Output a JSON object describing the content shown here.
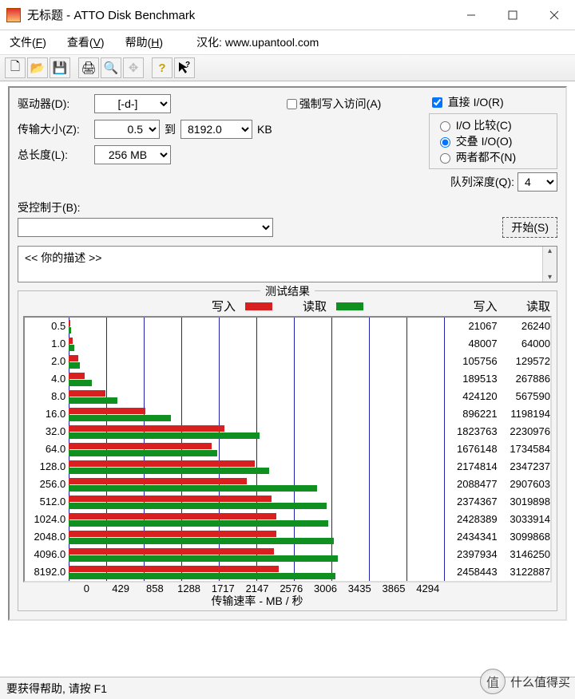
{
  "window": {
    "title": "无标题 - ATTO Disk Benchmark"
  },
  "menu": {
    "file": "文件(F)",
    "view": "查看(V)",
    "help": "帮助(H)",
    "hanhua_label": "汉化:",
    "hanhua_url": "www.upantool.com"
  },
  "options": {
    "drive_label": "驱动器(D):",
    "drive_value": "[-d-]",
    "transfer_label": "传输大小(Z):",
    "size_from": "0.5",
    "to_label": "到",
    "size_to": "8192.0",
    "kb": "KB",
    "length_label": "总长度(L):",
    "length_value": "256 MB",
    "force_write": "强制写入访问(A)",
    "direct_io": "直接 I/O(R)",
    "io_compare": "I/O 比较(C)",
    "overlap_io": "交叠 I/O(O)",
    "neither": "两者都不(N)",
    "queue_label": "队列深度(Q):",
    "queue_value": "4",
    "controlled_label": "受控制于(B):",
    "controlled_value": "",
    "start_btn": "开始(S)",
    "description": "<<  你的描述   >>"
  },
  "results": {
    "legend_title": "测试结果",
    "write_label": "写入",
    "read_label": "读取",
    "write_col": "写入",
    "read_col": "读取",
    "x_title": "传输速率 - MB / 秒"
  },
  "statusbar": {
    "text": "要获得帮助, 请按 F1"
  },
  "watermark": {
    "icon": "值",
    "text": "什么值得买"
  },
  "chart_data": {
    "type": "bar",
    "orientation": "horizontal",
    "categories": [
      "0.5",
      "1.0",
      "2.0",
      "4.0",
      "8.0",
      "16.0",
      "32.0",
      "64.0",
      "128.0",
      "256.0",
      "512.0",
      "1024.0",
      "2048.0",
      "4096.0",
      "8192.0"
    ],
    "x_ticks": [
      0,
      429,
      858,
      1288,
      1717,
      2147,
      2576,
      3006,
      3435,
      3865,
      4294
    ],
    "series": [
      {
        "name": "写入",
        "color": "#d82020",
        "values_kb": [
          21067,
          48007,
          105756,
          189513,
          424120,
          896221,
          1823763,
          1676148,
          2174814,
          2088477,
          2374367,
          2428389,
          2434341,
          2397934,
          2458443
        ]
      },
      {
        "name": "读取",
        "color": "#109020",
        "values_kb": [
          26240,
          64000,
          129572,
          267886,
          567590,
          1198194,
          2230976,
          1734584,
          2347237,
          2907603,
          3019898,
          3033914,
          3099868,
          3146250,
          3122887
        ]
      }
    ],
    "xlabel": "传输速率 - MB / 秒",
    "xlim": [
      0,
      4294
    ]
  }
}
